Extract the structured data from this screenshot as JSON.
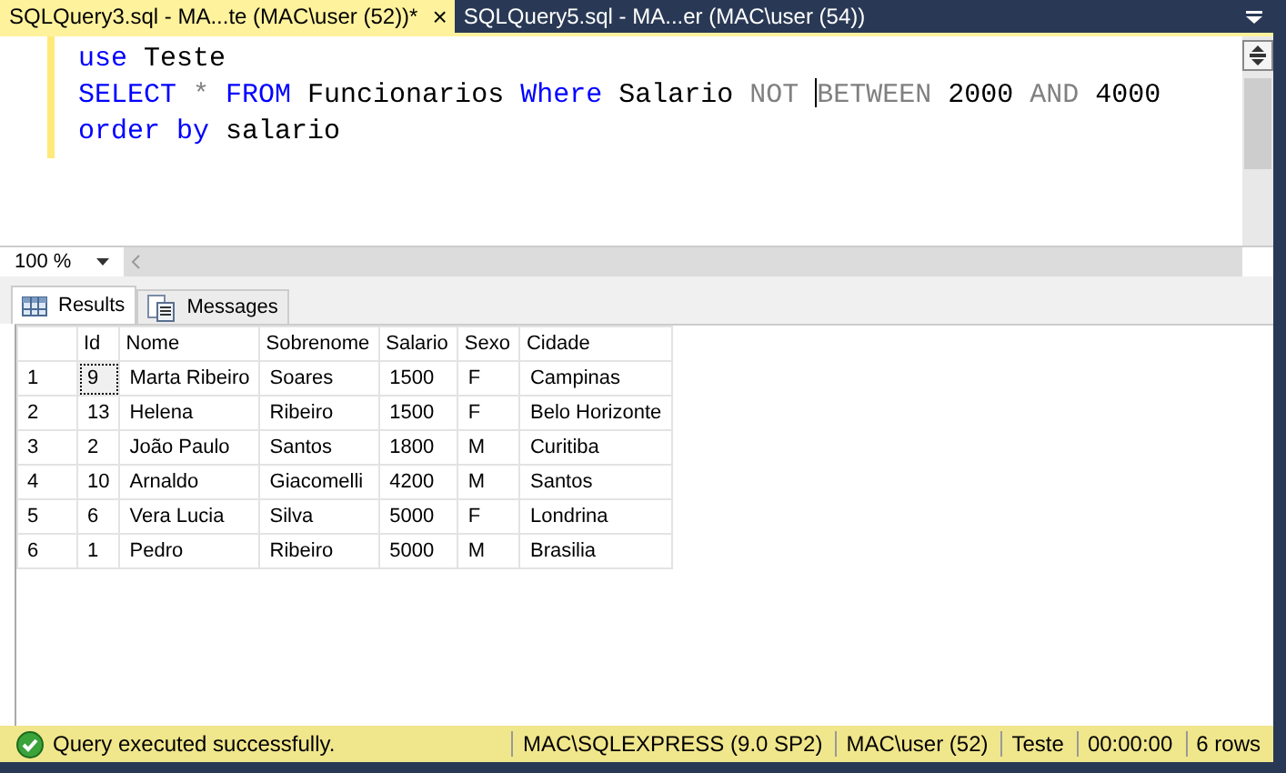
{
  "tabs": [
    {
      "label": "SQLQuery3.sql - MA...te (MAC\\user (52))*",
      "selected": true,
      "close": "×"
    },
    {
      "label": "SQLQuery5.sql - MA...er (MAC\\user (54))",
      "selected": false
    }
  ],
  "editor": {
    "lines": [
      [
        {
          "kind": "keyword",
          "text": "use"
        },
        {
          "kind": "plain",
          "text": " Teste"
        }
      ],
      [
        {
          "kind": "keyword",
          "text": "SELECT "
        },
        {
          "kind": "gray",
          "text": "* "
        },
        {
          "kind": "keyword",
          "text": "FROM"
        },
        {
          "kind": "plain",
          "text": " Funcionarios "
        },
        {
          "kind": "keyword",
          "text": "Where"
        },
        {
          "kind": "plain",
          "text": " Salario "
        },
        {
          "kind": "gray",
          "text": "NOT "
        },
        {
          "kind": "cursor"
        },
        {
          "kind": "gray",
          "text": "BETWEEN"
        },
        {
          "kind": "plain",
          "text": " 2000 "
        },
        {
          "kind": "gray",
          "text": "AND"
        },
        {
          "kind": "plain",
          "text": " 4000"
        }
      ],
      [
        {
          "kind": "keyword",
          "text": "order by"
        },
        {
          "kind": "plain",
          "text": " salario"
        }
      ]
    ]
  },
  "zoom": {
    "value": "100 %"
  },
  "result_tabs": [
    {
      "label": "Results",
      "selected": true
    },
    {
      "label": "Messages",
      "selected": false
    }
  ],
  "table": {
    "columns": [
      "Id",
      "Nome",
      "Sobrenome",
      "Salario",
      "Sexo",
      "Cidade"
    ],
    "rows": [
      {
        "number": "1",
        "focused": true,
        "cells": [
          "9",
          "Marta Ribeiro",
          "Soares",
          "1500",
          "F",
          "Campinas"
        ]
      },
      {
        "number": "2",
        "focused": false,
        "cells": [
          "13",
          "Helena",
          "Ribeiro",
          "1500",
          "F",
          "Belo Horizonte"
        ]
      },
      {
        "number": "3",
        "focused": false,
        "cells": [
          "2",
          "João Paulo",
          "Santos",
          "1800",
          "M",
          "Curitiba"
        ]
      },
      {
        "number": "4",
        "focused": false,
        "cells": [
          "10",
          "Arnaldo",
          "Giacomelli",
          "4200",
          "M",
          "Santos"
        ]
      },
      {
        "number": "5",
        "focused": false,
        "cells": [
          "6",
          "Vera Lucia",
          "Silva",
          "5000",
          "F",
          "Londrina"
        ]
      },
      {
        "number": "6",
        "focused": false,
        "cells": [
          "1",
          "Pedro",
          "Ribeiro",
          "5000",
          "M",
          "Brasilia"
        ]
      }
    ]
  },
  "status_bar": {
    "message": "Query executed successfully.",
    "segments": [
      "MAC\\SQLEXPRESS (9.0 SP2)",
      "MAC\\user (52)",
      "Teste",
      "00:00:00",
      "6 rows"
    ]
  }
}
